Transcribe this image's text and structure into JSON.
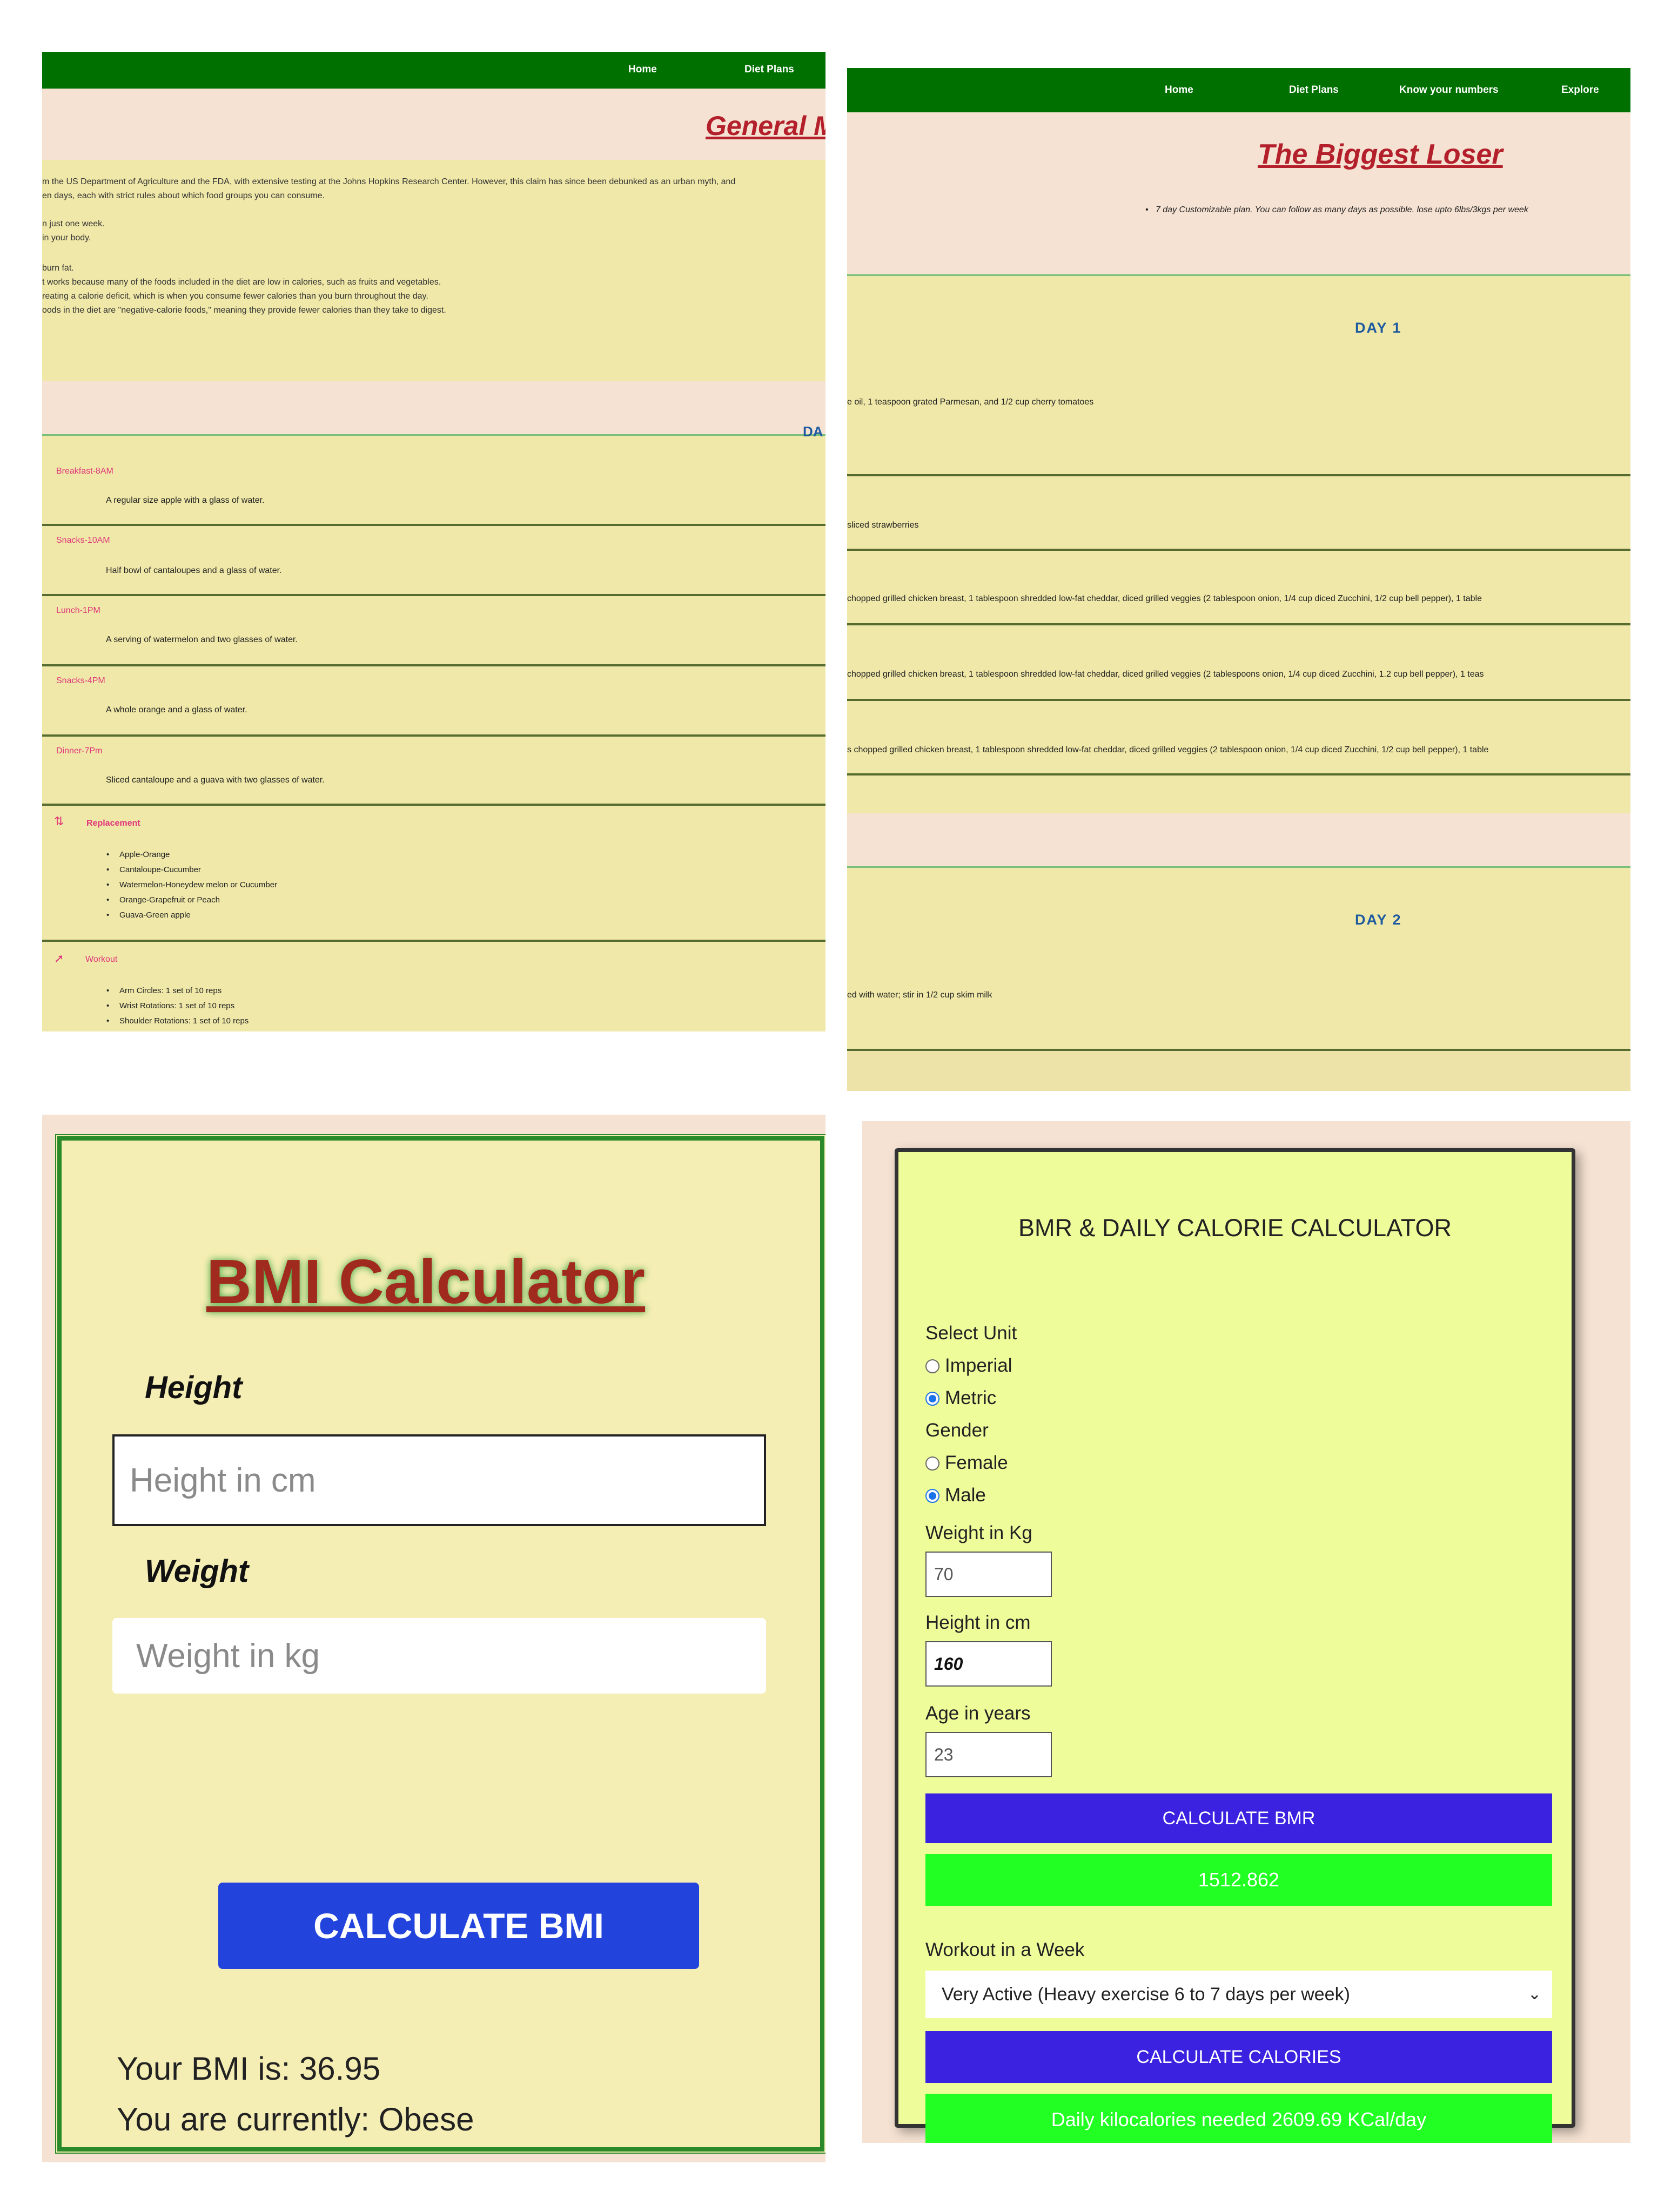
{
  "general_plan": {
    "nav": {
      "home": "Home",
      "diet_plans": "Diet Plans"
    },
    "title": "General M",
    "intro_lines": [
      "m the US Department of Agriculture and the FDA, with extensive testing at the Johns Hopkins Research Center. However, this claim has since been debunked as an urban myth, and",
      "en days, each with strict rules about which food groups you can consume.",
      "n just one week.",
      "in your body.",
      "burn fat.",
      "t works because many of the foods included in the diet are low in calories, such as fruits and vegetables.",
      "reating a calorie deficit, which is when you consume fewer calories than you burn throughout the day.",
      "oods in the diet are \"negative-calorie foods,\" meaning they provide fewer calories than they take to digest."
    ],
    "day_label": "DA",
    "meals": [
      {
        "time": "Breakfast-8AM",
        "text": "A regular size apple with a glass of water."
      },
      {
        "time": "Snacks-10AM",
        "text": "Half bowl of cantaloupes and a glass of water."
      },
      {
        "time": "Lunch-1PM",
        "text": "A serving of watermelon and two glasses of water."
      },
      {
        "time": "Snacks-4PM",
        "text": "A whole orange and a glass of water."
      },
      {
        "time": "Dinner-7Pm",
        "text": "Sliced cantaloupe and a guava with two glasses of water."
      }
    ],
    "replacement": {
      "label": "Replacement",
      "items": [
        "Apple-Orange",
        "Cantaloupe-Cucumber",
        "Watermelon-Honeydew melon or Cucumber",
        "Orange-Grapefruit or Peach",
        "Guava-Green apple"
      ]
    },
    "workout": {
      "label": "Workout",
      "items": [
        "Arm Circles: 1 set of 10 reps",
        "Wrist Rotations: 1 set of 10 reps",
        "Shoulder Rotations: 1 set of 10 reps"
      ]
    }
  },
  "biggest_loser": {
    "nav": {
      "home": "Home",
      "diet_plans": "Diet Plans",
      "know_numbers": "Know your numbers",
      "explore": "Explore"
    },
    "title": "The Biggest Loser",
    "bullet": "7 day Customizable plan. You can follow as many days as possible. lose upto 6lbs/3kgs per week",
    "day1": "DAY 1",
    "day1_lines": [
      "e oil, 1 teaspoon grated Parmesan, and 1/2 cup cherry tomatoes",
      "sliced strawberries",
      "chopped grilled chicken breast, 1 tablespoon shredded low-fat cheddar, diced grilled veggies (2 tablespoon onion, 1/4 cup diced Zucchini, 1/2 cup bell pepper), 1 table",
      "chopped grilled chicken breast, 1 tablespoon shredded low-fat cheddar, diced grilled veggies (2 tablespoons onion, 1/4 cup diced Zucchini, 1.2 cup bell pepper), 1 teas",
      "s chopped grilled chicken breast, 1 tablespoon shredded low-fat cheddar, diced grilled veggies (2 tablespoon onion, 1/4 cup diced Zucchini, 1/2 cup bell pepper), 1 table"
    ],
    "day2": "DAY 2",
    "day2_lines": [
      "ed with water; stir in 1/2 cup skim milk"
    ]
  },
  "bmi": {
    "title": "BMI Calculator",
    "height_label": "Height",
    "height_placeholder": "Height in cm",
    "weight_label": "Weight",
    "weight_placeholder": "Weight in kg",
    "button": "CALCULATE BMI",
    "result_line": "Your BMI is: 36.95",
    "status_line": "You are currently: Obese"
  },
  "bmr": {
    "title": "BMR & DAILY CALORIE CALCULATOR",
    "unit_label": "Select Unit",
    "unit_options": [
      "Imperial",
      "Metric"
    ],
    "unit_selected": "Metric",
    "gender_label": "Gender",
    "gender_options": [
      "Female",
      "Male"
    ],
    "gender_selected": "Male",
    "weight_label": "Weight in Kg",
    "weight_value": "70",
    "height_label": "Height in cm",
    "height_value": "160",
    "age_label": "Age in years",
    "age_value": "23",
    "calc_bmr_button": "CALCULATE BMR",
    "bmr_result": "1512.862",
    "workout_label": "Workout in a Week",
    "workout_selected": "Very Active (Heavy exercise 6 to 7 days per week)",
    "calc_calories_button": "CALCULATE CALORIES",
    "calories_result": "Daily kilocalories needed 2609.69 KCal/day"
  }
}
